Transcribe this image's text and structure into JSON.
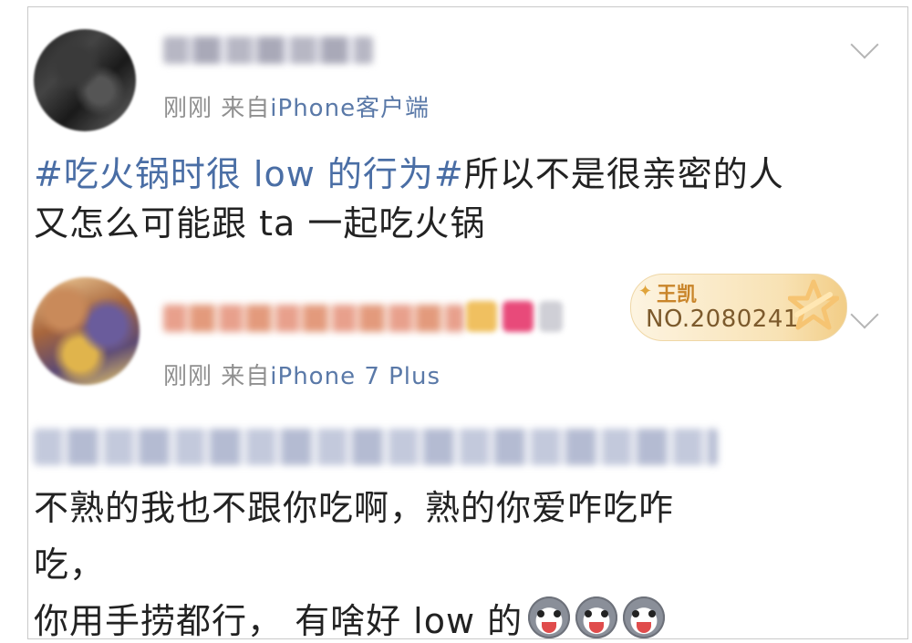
{
  "post1": {
    "meta_time": "刚刚",
    "meta_from": "来自",
    "meta_source": "iPhone客户端",
    "hashtag": "#吃火锅时很 low 的行为#",
    "line1_rest": "所以不是很亲密的人",
    "line2": "又怎么可能跟 ta 一起吃火锅"
  },
  "post2": {
    "badge_name": "王凯",
    "badge_number": "NO.2080241",
    "meta_time": "刚刚",
    "meta_from": "来自",
    "meta_source": "iPhone 7 Plus",
    "line1": "不熟的我也不跟你吃啊，熟的你爱咋吃咋",
    "line2": "吃，",
    "line3": "你用手捞都行， 有啥好 low 的"
  },
  "icons": {
    "expand": "chevron-down-icon",
    "emoji": "husky-dog-emoji"
  }
}
